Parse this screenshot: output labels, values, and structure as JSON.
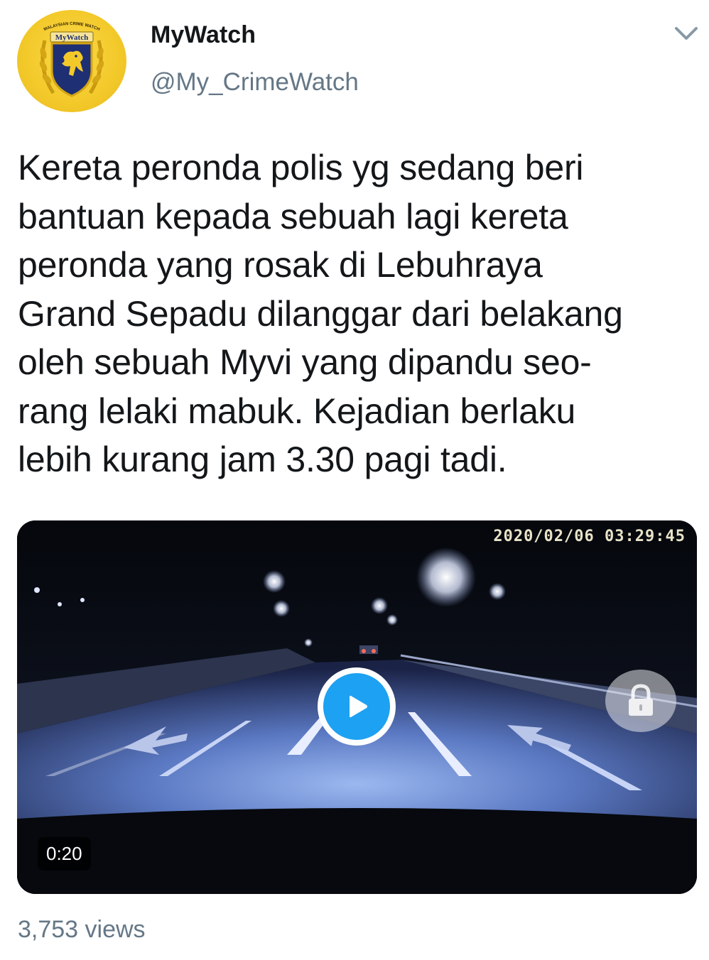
{
  "tweet": {
    "user": {
      "name": "MyWatch",
      "handle": "@My_CrimeWatch",
      "avatar": {
        "arc_text": "MALAYSIAN CRIME WATCH",
        "badge_text": "MyWatch",
        "icon": "lion-shield-logo"
      }
    },
    "menu_icon": "chevron-down-icon",
    "text": "Kereta peronda polis yg sedang beri\nbantuan kepada sebuah lagi kereta\nperonda yang rosak di Lebuhraya\nGrand Sepadu dilanggar dari belakang\noleh sebuah Myvi yang dipandu seo-\nrang lelaki mabuk. Kejadian berlaku\nlebih kurang jam 3.30 pagi tadi.",
    "media": {
      "type": "video",
      "timestamp_overlay": "2020/02/06 03:29:45",
      "duration": "0:20",
      "play_icon": "play-icon",
      "lock_icon": "lock-icon"
    },
    "views": "3,753 views"
  },
  "colors": {
    "name_text": "#14171a",
    "secondary_text": "#657786",
    "play_accent": "#1da1f2",
    "avatar_gold": "#f3c92a",
    "shield_navy": "#1f2f73"
  }
}
